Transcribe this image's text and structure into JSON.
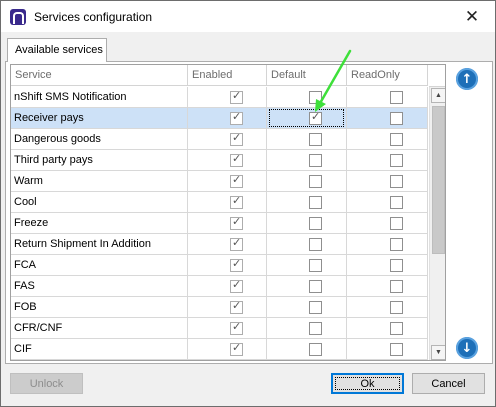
{
  "window": {
    "title": "Services configuration",
    "close_glyph": "✕"
  },
  "tab": {
    "label": "Available services"
  },
  "grid": {
    "columns": [
      "Service",
      "Enabled",
      "Default",
      "ReadOnly"
    ],
    "rows": [
      {
        "service": "nShift SMS Notification",
        "enabled": true,
        "default": false,
        "readonly": false
      },
      {
        "service": "Receiver pays",
        "enabled": true,
        "default": true,
        "readonly": false,
        "selected": true
      },
      {
        "service": "Dangerous goods",
        "enabled": true,
        "default": false,
        "readonly": false
      },
      {
        "service": "Third party pays",
        "enabled": true,
        "default": false,
        "readonly": false
      },
      {
        "service": "Warm",
        "enabled": true,
        "default": false,
        "readonly": false
      },
      {
        "service": "Cool",
        "enabled": true,
        "default": false,
        "readonly": false
      },
      {
        "service": "Freeze",
        "enabled": true,
        "default": false,
        "readonly": false
      },
      {
        "service": "Return Shipment In Addition",
        "enabled": true,
        "default": false,
        "readonly": false
      },
      {
        "service": "FCA",
        "enabled": true,
        "default": false,
        "readonly": false
      },
      {
        "service": "FAS",
        "enabled": true,
        "default": false,
        "readonly": false
      },
      {
        "service": "FOB",
        "enabled": true,
        "default": false,
        "readonly": false
      },
      {
        "service": "CFR/CNF",
        "enabled": true,
        "default": false,
        "readonly": false
      },
      {
        "service": "CIF",
        "enabled": true,
        "default": false,
        "readonly": false
      }
    ]
  },
  "buttons": {
    "unlock": "Unlock",
    "ok": "Ok",
    "cancel": "Cancel"
  },
  "icons": {
    "move_up": "arrow-up-circle-icon",
    "move_down": "arrow-down-circle-icon"
  },
  "colors": {
    "annotation_arrow": "#3ee03a",
    "selection": "#cde1f7",
    "accent": "#0078d7"
  }
}
